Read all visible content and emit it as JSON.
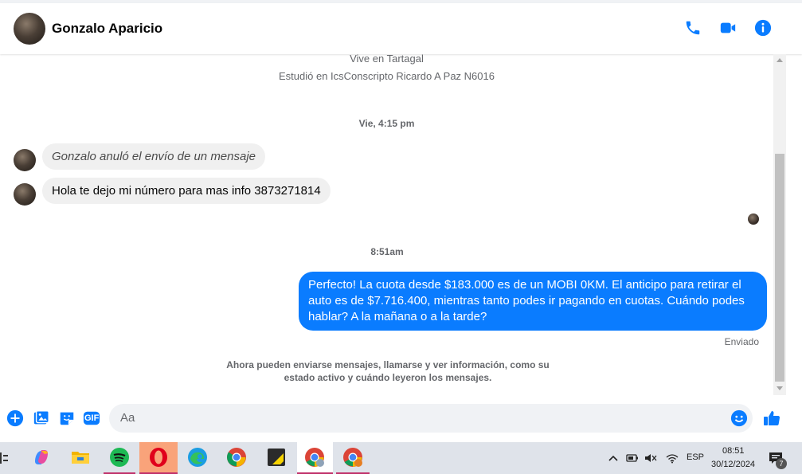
{
  "header": {
    "contact_name": "Gonzalo Aparicio",
    "icons": [
      "phone-icon",
      "video-icon",
      "info-icon"
    ]
  },
  "profile_info": {
    "lives_in": "Vive en Tartagal",
    "studied_at": "Estudió en IcsConscripto Ricardo A Paz N6016"
  },
  "messages": {
    "timestamp_1": "Vie, 4:15 pm",
    "incoming_1": "Gonzalo anuló el envío de un mensaje",
    "incoming_2": "Hola te dejo mi número para mas info 3873271814",
    "timestamp_2": "8:51am",
    "outgoing_1": "Perfecto! La cuota desde $183.000 es de un MOBI 0KM. El anticipo para retirar el auto es de $7.716.400, mientras tanto podes ir pagando en cuotas. Cuándo podes hablar? A la mañana o a la tarde?",
    "outgoing_status": "Enviado",
    "notice": "Ahora pueden enviarse mensajes, llamarse y ver información, como su estado activo y cuándo leyeron los mensajes."
  },
  "composer": {
    "placeholder": "Aa",
    "icons": [
      "plus-icon",
      "image-icon",
      "sticker-icon",
      "gif-icon",
      "emoji-icon",
      "like-icon"
    ],
    "gif_label": "GIF"
  },
  "taskbar": {
    "apps": [
      "copilot-icon",
      "file-explorer-icon",
      "spotify-icon",
      "opera-icon",
      "edge-icon",
      "chrome-icon",
      "sticky-notes-icon",
      "chrome-profile-icon",
      "chrome-profile-2-icon"
    ],
    "language": "ESP",
    "time": "08:51",
    "date": "30/12/2024",
    "notification_count": "7"
  },
  "colors": {
    "accent": "#0a7cff",
    "bubble_in": "#f0f0f0",
    "taskbar": "#dfe3ea"
  }
}
